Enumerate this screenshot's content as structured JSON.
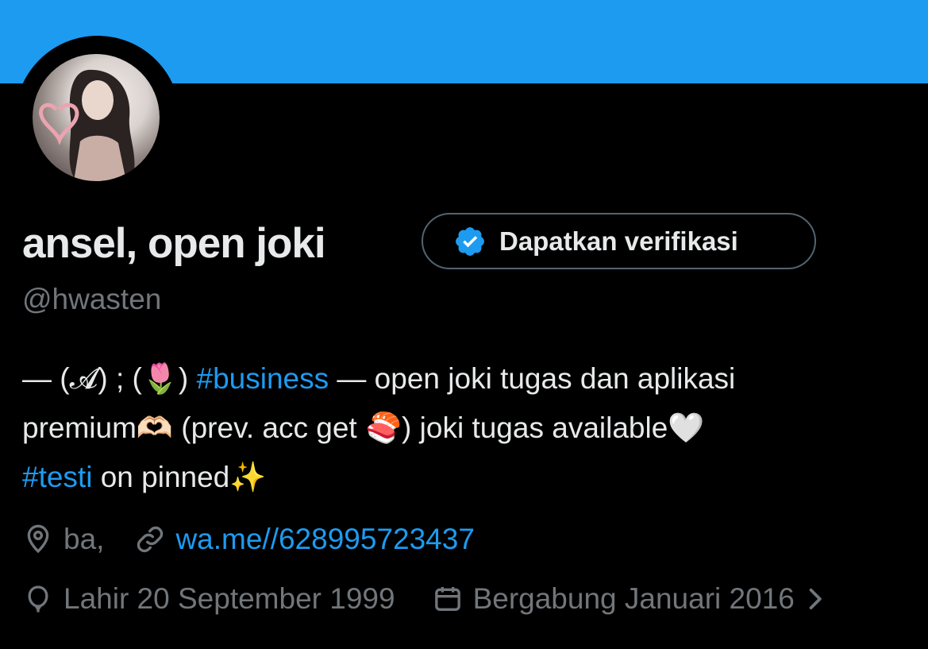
{
  "profile": {
    "name": "ansel, open joki",
    "handle": "@hwasten",
    "verify_button_label": "Dapatkan verifikasi",
    "bio": {
      "line1_prefix": "— (𝓐) ; (",
      "line1_emoji": "🌷",
      "line1_close": ") ",
      "hashtag_business": "#business",
      "line1_suffix": " — open joki tugas dan aplikasi",
      "line2_prefix": "premium",
      "line2_emoji1": "🫶🏻",
      "line2_mid": " (prev. acc get ",
      "line2_emoji2": "🍣",
      "line2_suffix": ") joki tugas available",
      "line2_emoji3": "🤍",
      "hashtag_testi": "#testi",
      "line3_suffix": " on pinned",
      "line3_emoji": "✨"
    },
    "location": "ba,",
    "website": "wa.me//628995723437",
    "birthday": "Lahir 20 September 1999",
    "joined": "Bergabung Januari 2016"
  },
  "icons": {
    "verified": "verified-badge-icon",
    "location": "location-pin-icon",
    "link": "link-icon",
    "birthday": "balloon-icon",
    "calendar": "calendar-icon",
    "chevron": "chevron-right-icon"
  },
  "colors": {
    "banner": "#1d9bf0",
    "accent": "#1d9bf0",
    "background": "#000000",
    "text": "#e7e9ea",
    "muted": "#71767b"
  }
}
